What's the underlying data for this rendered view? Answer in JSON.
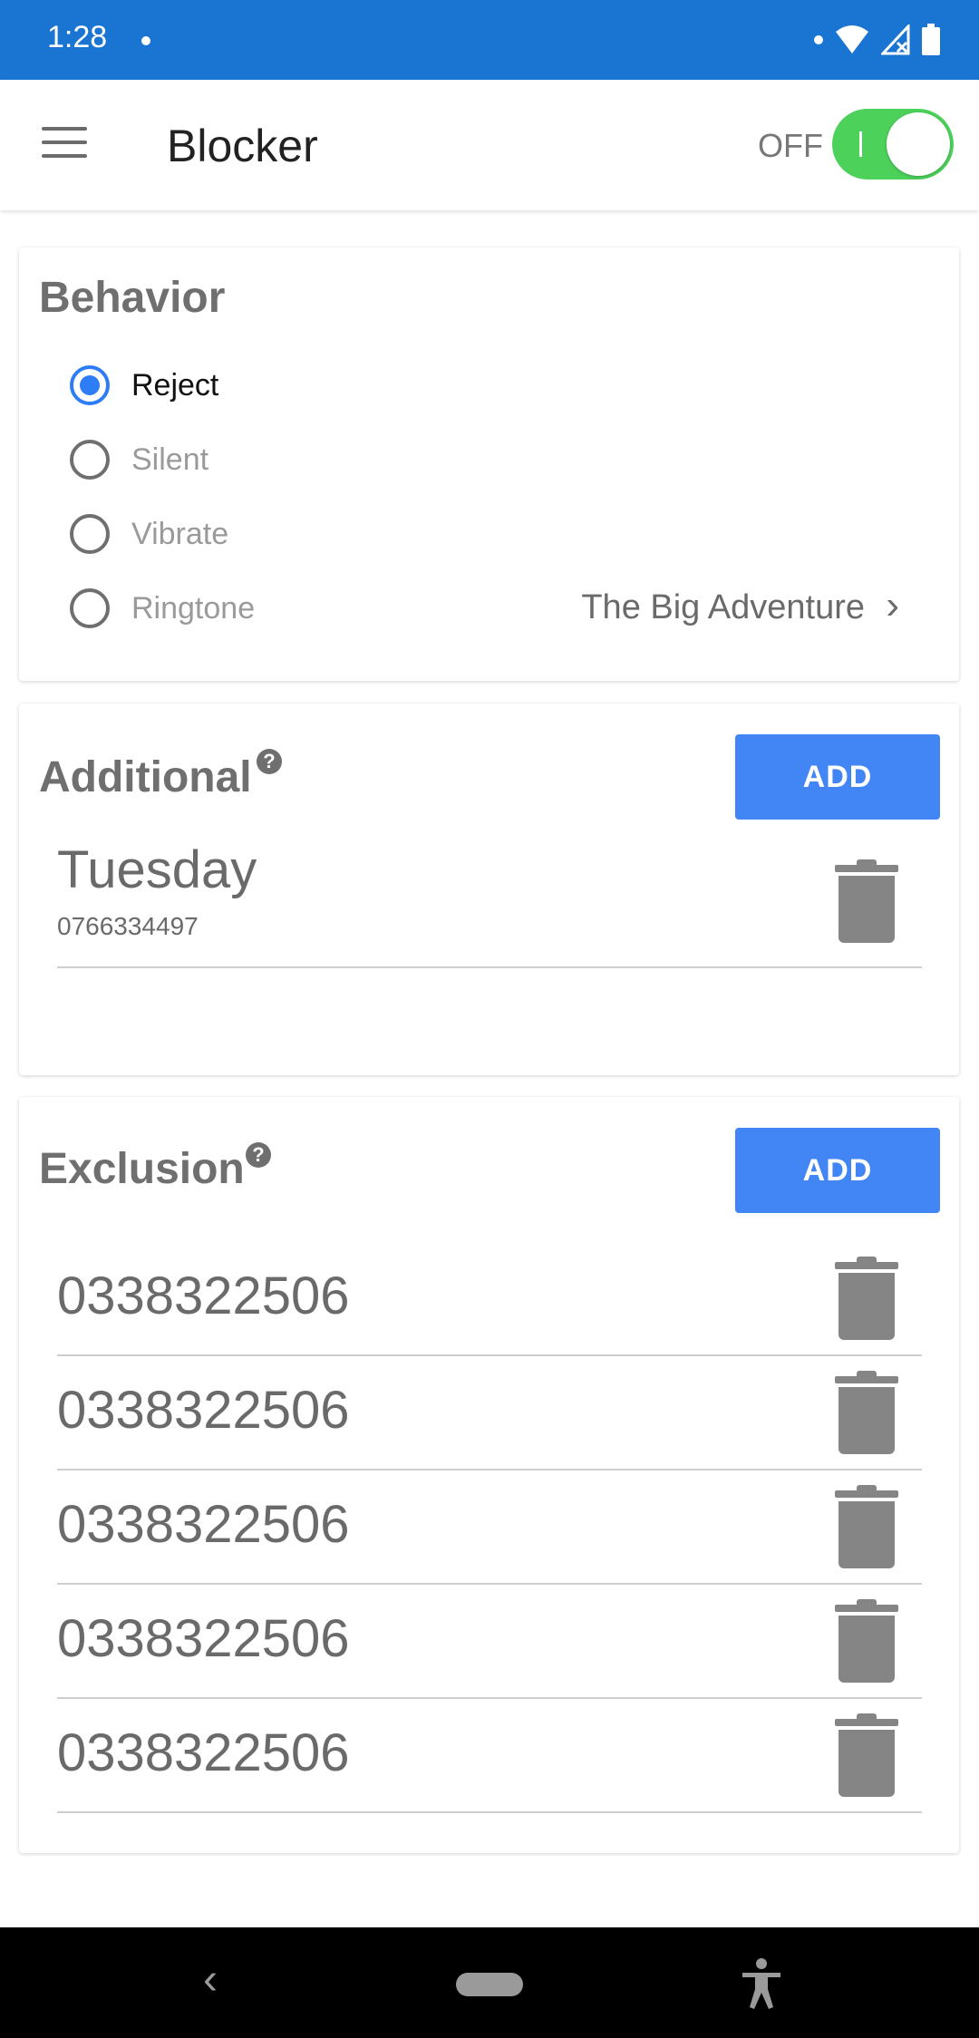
{
  "status_bar": {
    "time": "1:28"
  },
  "app_bar": {
    "title": "Blocker",
    "toggle_label": "OFF"
  },
  "behavior": {
    "title": "Behavior",
    "options": [
      {
        "label": "Reject",
        "checked": true
      },
      {
        "label": "Silent",
        "checked": false
      },
      {
        "label": "Vibrate",
        "checked": false
      },
      {
        "label": "Ringtone",
        "checked": false
      }
    ],
    "ringtone_value": "The Big Adventure"
  },
  "additional": {
    "title": "Additional",
    "add_label": "ADD",
    "entries": [
      {
        "name": "Tuesday",
        "number": "0766334497"
      }
    ]
  },
  "exclusion": {
    "title": "Exclusion",
    "add_label": "ADD",
    "entries": [
      "0338322506",
      "0338322506",
      "0338322506",
      "0338322506",
      "0338322506"
    ]
  },
  "colors": {
    "accent": "#4285f4",
    "status_bar": "#1a74d2",
    "toggle": "#4cd15b"
  },
  "icons": [
    "menu-icon",
    "help-icon",
    "chevron-right-icon",
    "trash-icon",
    "back-icon",
    "home-icon",
    "accessibility-icon",
    "wifi-icon",
    "signal-icon",
    "battery-icon"
  ]
}
